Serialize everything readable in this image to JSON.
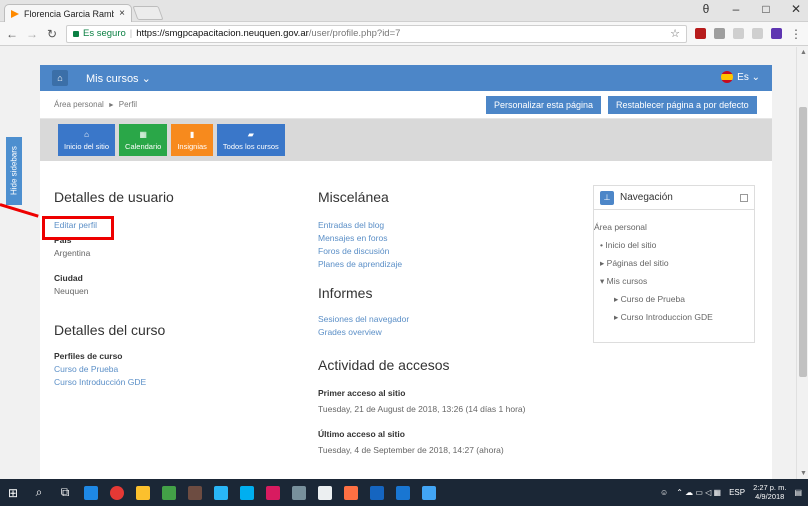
{
  "browser": {
    "tab_title": "Florencia Garcia Rambeu",
    "tab_close": "×",
    "secure_label": "Es seguro",
    "url_host": "https://smgpcapacitacion.neuquen.gov.ar",
    "url_path": "/user/profile.php?id=7",
    "win_min": "–",
    "win_max": "□",
    "win_close": "✕",
    "win_account": "θ"
  },
  "navbar": {
    "home_icon": "home-icon",
    "courses_label": "Mis cursos ⌄",
    "language_label": "Es ⌄"
  },
  "breadcrumb": {
    "items": [
      "Área personal",
      "Perfil"
    ]
  },
  "page_buttons": {
    "customize": "Personalizar esta página",
    "reset": "Restablecer página a por defecto"
  },
  "tiles": [
    {
      "label": "Inicio del sitio",
      "icon": "home-icon",
      "color": "#3a77c9"
    },
    {
      "label": "Calendario",
      "icon": "calendar-icon",
      "color": "#2aa748"
    },
    {
      "label": "Insignias",
      "icon": "bookmark-icon",
      "color": "#f78a1d"
    },
    {
      "label": "Todos los cursos",
      "icon": "archive-icon",
      "color": "#3a77c9"
    }
  ],
  "sidebar_toggle": "Hide sidebars",
  "user_details": {
    "heading": "Detalles de usuario",
    "edit_profile": "Editar perfil",
    "country_label": "País",
    "country_value": "Argentina",
    "city_label": "Ciudad",
    "city_value": "Neuquen"
  },
  "course_details": {
    "heading": "Detalles del curso",
    "profiles_label": "Perfiles de curso",
    "courses": [
      "Curso de Prueba",
      "Curso Introducción GDE"
    ]
  },
  "misc": {
    "heading": "Miscelánea",
    "links": [
      "Entradas del blog",
      "Mensajes en foros",
      "Foros de discusión",
      "Planes de aprendizaje"
    ]
  },
  "reports": {
    "heading": "Informes",
    "links": [
      "Sesiones del navegador",
      "Grades overview"
    ]
  },
  "access": {
    "heading": "Actividad de accesos",
    "first_label": "Primer acceso al sitio",
    "first_value": "Tuesday, 21 de August de 2018, 13:26  (14 días 1 hora)",
    "last_label": "Último acceso al sitio",
    "last_value": "Tuesday, 4 de September de 2018, 14:27  (ahora)"
  },
  "navigation_block": {
    "title": "Navegación",
    "root": "Área personal",
    "items": [
      "Inicio del sitio",
      "Páginas del sitio",
      "Mis cursos"
    ],
    "courses": [
      "Curso de Prueba",
      "Curso Introduccion GDE"
    ]
  },
  "taskbar": {
    "lang": "ESP",
    "time": "2:27 p. m.",
    "date": "4/9/2018"
  }
}
